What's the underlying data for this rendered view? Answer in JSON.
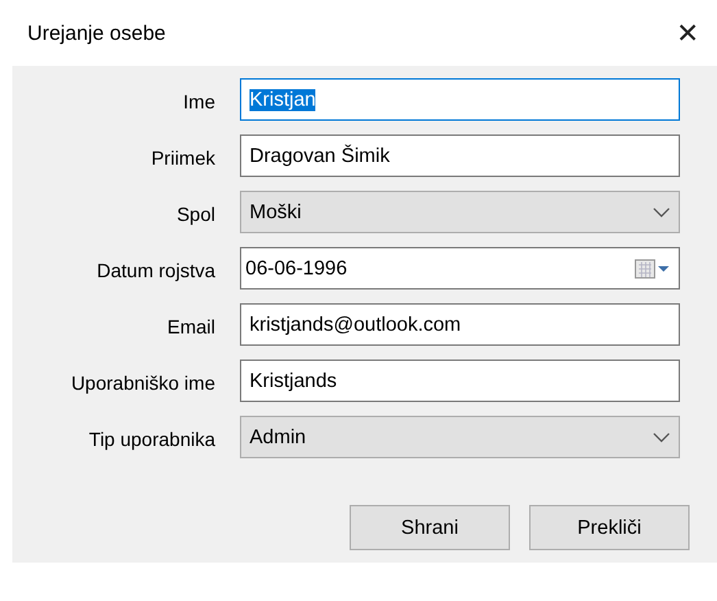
{
  "window": {
    "title": "Urejanje osebe",
    "close": "✕"
  },
  "fields": [
    {
      "label": "Ime",
      "kind": "text",
      "value": "Kristjan",
      "focused": true
    },
    {
      "label": "Priimek",
      "kind": "text",
      "value": "Dragovan Šimik",
      "focused": false
    },
    {
      "label": "Spol",
      "kind": "select",
      "value": "Moški",
      "focused": false
    },
    {
      "label": "Datum rojstva",
      "kind": "date",
      "value": "06-06-1996",
      "focused": false
    },
    {
      "label": "Email",
      "kind": "text",
      "value": "kristjands@outlook.com",
      "focused": false
    },
    {
      "label": "Uporabniško ime",
      "kind": "text",
      "value": "Kristjands",
      "focused": false
    },
    {
      "label": "Tip uporabnika",
      "kind": "select",
      "value": "Admin",
      "focused": false
    }
  ],
  "buttons": [
    "Shrani",
    "Prekliči"
  ]
}
